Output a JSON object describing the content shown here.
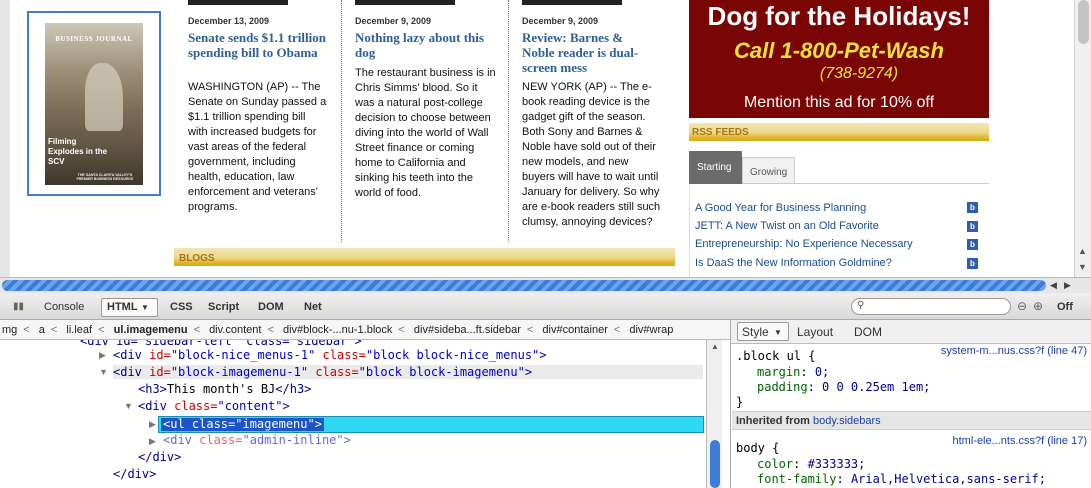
{
  "cover": {
    "masthead": "BUSINESS JOURNAL",
    "caption": "Filming Explodes in the SCV",
    "footer": "THE SANTA CLARITA VALLEY'S PREMIER BUSINESS RESOURCE"
  },
  "articles": [
    {
      "date": "December 13, 2009",
      "title": "Senate sends $1.1 trillion spending bill to Obama",
      "text": "WASHINGTON (AP) -- The Senate on Sunday passed a $1.1 trillion spending bill with increased budgets for vast areas of the federal government, including health, education, law enforcement and veterans' programs."
    },
    {
      "date": "December 9, 2009",
      "title": "Nothing lazy about this dog",
      "text": "The restaurant business is in Chris Simms' blood. So it was a natural post-college decision to choose between diving into the world of Wall Street finance or coming home to California and sinking his teeth into the world of food."
    },
    {
      "date": "December 9, 2009",
      "title": "Review: Barnes & Noble reader is dual-screen mess",
      "text": "NEW YORK (AP) -- The e-book reading device is the gadget gift of the season. Both Sony and Barnes & Noble have sold out of their new models, and new buyers will have to wait until January for delivery. So why are e-book readers still such clumsy, annoying devices?"
    }
  ],
  "blogs_label": "BLOGS",
  "ad": {
    "line1": "Dog for the Holidays!",
    "line2": "Call 1-800-Pet-Wash",
    "line3": "(738-9274)",
    "line4": "Mention this ad for 10% off"
  },
  "rss": {
    "label": "RSS FEEDS",
    "tabs": [
      "Starting",
      "Growing"
    ],
    "feeds": [
      "A Good Year for Business Planning",
      "JETT: A New Twist on an Old Favorite",
      "Entrepreneurship: No Experience Necessary",
      "Is DaaS the New Information Goldmine?"
    ],
    "feed_icon": "b"
  },
  "firebug": {
    "tabs": [
      "Console",
      "HTML",
      "CSS",
      "Script",
      "DOM",
      "Net"
    ],
    "active_tab": "HTML",
    "off_label": "Off",
    "breadcrumbs": [
      "mg",
      "a",
      "li.leaf",
      "ul.imagemenu",
      "div.content",
      "div#block-...nu-1.block",
      "div#sideba...ft.sidebar",
      "div#container",
      "div#wrap"
    ],
    "breadcrumb_current": "ul.imagemenu",
    "html_lines": {
      "top": "<div id=\"sidebar-left\" class=\"sidebar\">",
      "l1_tag": "<div",
      "l1_attr1_name": " id=",
      "l1_attr1_val": "\"block-nice_menus-1\"",
      "l1_attr2_name": " class=",
      "l1_attr2_val": "\"block block-nice_menus\"",
      "l2_attr1_val": "\"block-imagemenu-1\"",
      "l2_attr2_val": "\"block block-imagemenu\"",
      "h3_open": "<h3>",
      "h3_text": "This month's BJ",
      "h3_close": "</h3>",
      "content_open": "<div",
      "content_class": "\"content\"",
      "selected": "<ul class=\"imagemenu\">",
      "admin_open": "<div",
      "admin_class": "\"admin-inline\"",
      "div_close1": "</div>",
      "div_close2": "</div>"
    },
    "side_tabs": [
      "Style",
      "Layout",
      "DOM"
    ],
    "rule1": {
      "selector": ".block ul {",
      "source": "system-m...nus.css?f (line 47)",
      "props": [
        {
          "name": "margin",
          "value": "0;"
        },
        {
          "name": "padding",
          "value": "0 0 0.25em 1em;"
        }
      ],
      "close": "}"
    },
    "inherited": {
      "label": "Inherited from",
      "from": "body.sidebars"
    },
    "rule2": {
      "selector": "body {",
      "source": "html-ele...nts.css?f (line 17)",
      "props": [
        {
          "name": "color",
          "value": "#333333;"
        },
        {
          "name": "font-family",
          "value": "Arial,Helvetica,sans-serif;"
        }
      ]
    }
  },
  "colors": {
    "link_blue": "#2f5f94",
    "ad_red": "#7a0505",
    "ad_yellow": "#f6e23a",
    "gold_bar": "#e0b62b",
    "selection_cyan": "#2fd8f3"
  }
}
